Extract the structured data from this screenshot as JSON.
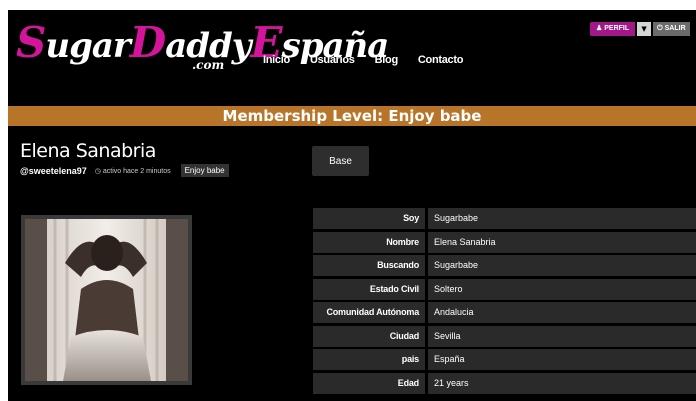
{
  "brand": {
    "logo_text": "SugarDaddyEspaña",
    "logo_sub": ".com"
  },
  "nav": {
    "items": [
      "Inicio",
      "Usuarios",
      "Blog",
      "Contacto"
    ]
  },
  "top_controls": {
    "perfil_label": "PERFIL",
    "salir_label": "SALIR"
  },
  "banner": {
    "text": "Membership Level: Enjoy babe"
  },
  "profile": {
    "name": "Elena Sanabria",
    "username": "@sweetelena97",
    "active": "activo hace 2 minutos",
    "level": "Enjoy babe"
  },
  "tabs": {
    "base_label": "Base"
  },
  "details": [
    {
      "label": "Soy",
      "value": "Sugarbabe"
    },
    {
      "label": "Nombre",
      "value": "Elena Sanabria"
    },
    {
      "label": "Buscando",
      "value": "Sugarbabe"
    },
    {
      "label": "Estado Civil",
      "value": "Soltero"
    },
    {
      "label": "Comunidad Autónoma",
      "value": "Andalucia"
    },
    {
      "label": "Ciudad",
      "value": "Sevilla"
    },
    {
      "label": "pais",
      "value": "España"
    },
    {
      "label": "Edad",
      "value": "21 years"
    }
  ],
  "colors": {
    "brand_pink": "#d4149a",
    "perfil_purple": "#a0188a",
    "banner_orange": "#b8752a"
  }
}
